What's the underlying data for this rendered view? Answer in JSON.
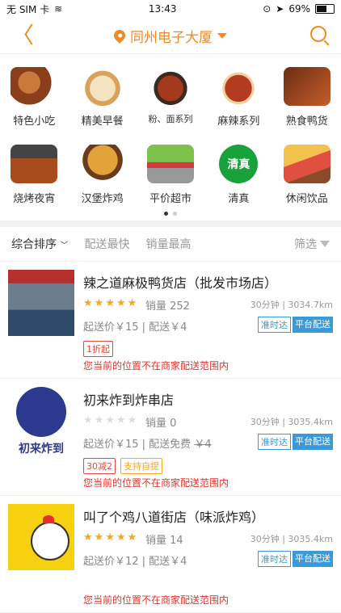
{
  "status": {
    "carrier": "无 SIM 卡",
    "time": "13:43",
    "battery": "69%",
    "battery_level": 0.69
  },
  "header": {
    "location": "同州电子大厦"
  },
  "categories": [
    {
      "label": "特色小吃",
      "icon": "snack-icon"
    },
    {
      "label": "精美早餐",
      "icon": "breakfast-icon"
    },
    {
      "label": "粉、面系列",
      "icon": "noodle-icon"
    },
    {
      "label": "麻辣系列",
      "icon": "spicy-icon"
    },
    {
      "label": "熟食鸭货",
      "icon": "duck-icon"
    },
    {
      "label": "烧烤夜宵",
      "icon": "bbq-icon"
    },
    {
      "label": "汉堡炸鸡",
      "icon": "burger-icon"
    },
    {
      "label": "平价超市",
      "icon": "cart-icon"
    },
    {
      "label": "清真",
      "icon": "halal-icon",
      "icon_text": "清真"
    },
    {
      "label": "休闲饮品",
      "icon": "drink-icon"
    }
  ],
  "pagination": {
    "total": 2,
    "current": 1
  },
  "sort": {
    "items": [
      "综合排序",
      "配送最快",
      "销量最高"
    ],
    "filter": "筛选"
  },
  "stores": [
    {
      "name": "辣之道麻极鸭货店（批发市场店）",
      "rating": 5,
      "sales": "销量 252",
      "time": "30分钟",
      "distance": "3034.7km",
      "fee": "起送价￥15 | 配送￥4",
      "fee_strike": "",
      "tags": [
        "1折起"
      ],
      "badges": [
        "准时达",
        "平台配送"
      ],
      "warning": "您当前的位置不在商家配送范围内"
    },
    {
      "name": "初来炸到炸串店",
      "rating": 0,
      "sales": "销量 0",
      "time": "30分钟",
      "distance": "3035.4km",
      "fee": "起送价￥15 | 配送免费",
      "fee_strike": "￥4",
      "tags": [
        "30减2",
        "支持自提"
      ],
      "badges": [
        "准时达",
        "平台配送"
      ],
      "warning": "您当前的位置不在商家配送范围内",
      "brand": "初来炸到"
    },
    {
      "name": "叫了个鸡八道街店（味派炸鸡）",
      "rating": 5,
      "sales": "销量 14",
      "time": "30分钟",
      "distance": "3035.4km",
      "fee": "起送价￥12 | 配送￥4",
      "fee_strike": "",
      "tags": [],
      "badges": [
        "准时达",
        "平台配送"
      ],
      "warning": "您当前的位置不在商家配送范围内"
    }
  ]
}
